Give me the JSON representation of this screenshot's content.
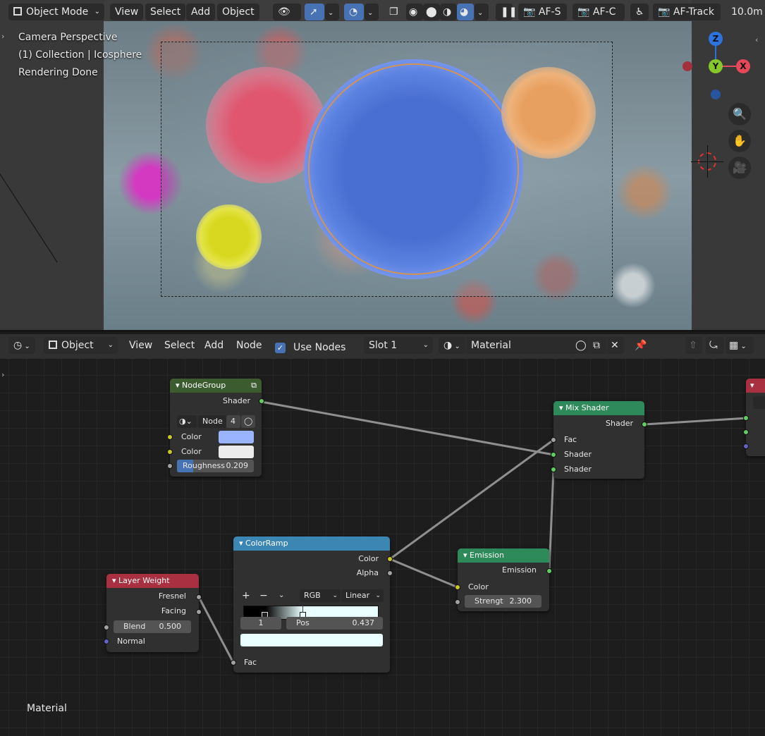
{
  "viewport": {
    "mode": "Object Mode",
    "menus": [
      "View",
      "Select",
      "Add",
      "Object"
    ],
    "af_s": "AF-S",
    "af_c": "AF-C",
    "af_track": "AF-Track",
    "distance": "10.0m",
    "info": [
      "Camera Perspective",
      "(1) Collection | Icosphere",
      "Rendering Done"
    ],
    "gizmo": {
      "z": "Z",
      "y": "Y",
      "x": "X"
    }
  },
  "node_editor": {
    "object_mode": "Object",
    "menus": [
      "View",
      "Select",
      "Add",
      "Node"
    ],
    "use_nodes_label": "Use Nodes",
    "use_nodes_checked": true,
    "slot": "Slot 1",
    "material_name": "Material",
    "footer_label": "Material"
  },
  "nodes": {
    "nodegroup": {
      "title": "NodeGroup",
      "output": "Shader",
      "node_label": "Node",
      "node_users": "4",
      "color1_label": "Color",
      "color1": "#9bb4ff",
      "color2_label": "Color",
      "color2": "#ececec",
      "roughness_label": "Roughness",
      "roughness_value": "0.209",
      "roughness": 0.209
    },
    "mix_shader": {
      "title": "Mix Shader",
      "output": "Shader",
      "inputs": [
        "Fac",
        "Shader",
        "Shader"
      ]
    },
    "colorramp": {
      "title": "ColorRamp",
      "outputs": [
        "Color",
        "Alpha"
      ],
      "color_mode": "RGB",
      "interpolation": "Linear",
      "stop_index": "1",
      "pos_label": "Pos",
      "pos_value": "0.437",
      "stop_color": "#eaffff",
      "input": "Fac"
    },
    "layer_weight": {
      "title": "Layer Weight",
      "outputs": [
        "Fresnel",
        "Facing"
      ],
      "blend_label": "Blend",
      "blend_value": "0.500",
      "input_normal": "Normal"
    },
    "emission": {
      "title": "Emission",
      "output": "Emission",
      "color_label": "Color",
      "strength_label": "Strengt",
      "strength_value": "2.300"
    }
  },
  "colors": {
    "accent_blue": "#4772b3",
    "header_shader": "#2e8a5a",
    "header_input": "#a83040",
    "header_converter": "#3b86b3",
    "header_group": "#3c5c30"
  },
  "icons": [
    "object-mode-icon",
    "dropdown-icon",
    "eye-icon",
    "gizmo-icon",
    "overlay-icon",
    "xray-icon",
    "wireframe-icon",
    "solid-icon",
    "material-icon",
    "rendered-icon",
    "pause-icon",
    "camera-icon",
    "zoom-icon",
    "hand-icon",
    "camera-view-icon",
    "editor-type-icon",
    "browse-material-icon",
    "fake-user-icon",
    "duplicate-icon",
    "close-icon",
    "pin-icon",
    "parent-icon",
    "snap-icon"
  ]
}
